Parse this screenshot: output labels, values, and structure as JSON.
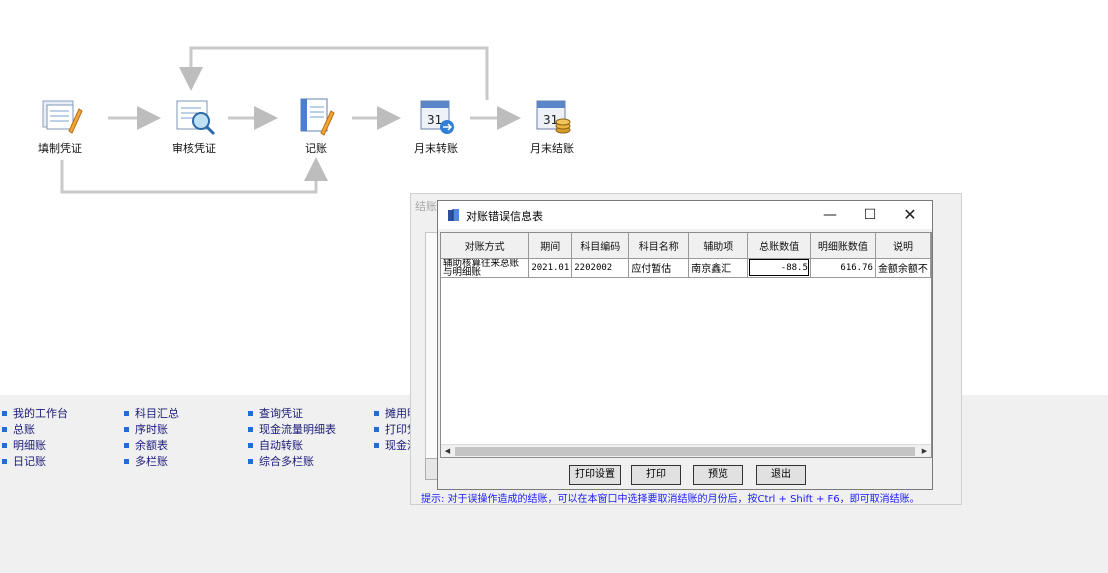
{
  "flow": {
    "nodes": [
      {
        "label": "填制凭证",
        "icon": "voucher-entry-icon"
      },
      {
        "label": "审核凭证",
        "icon": "voucher-review-icon"
      },
      {
        "label": "记账",
        "icon": "posting-icon"
      },
      {
        "label": "月末转账",
        "icon": "month-end-transfer-icon"
      },
      {
        "label": "月末结账",
        "icon": "month-end-close-icon"
      }
    ]
  },
  "background_panel": {
    "title": "结账",
    "tip": "提示: 对于误操作造成的结账，可以在本窗口中选择要取消结账的月份后，按Ctrl + Shift + F6，即可取消结账。"
  },
  "dialog": {
    "title": "对账错误信息表",
    "icon": "book-icon",
    "window_buttons": {
      "minimize": "—",
      "maximize": "☐",
      "close": "✕"
    },
    "columns": [
      "对账方式",
      "期间",
      "科目编码",
      "科目名称",
      "辅助项",
      "总账数值",
      "明细账数值",
      "说明"
    ],
    "rows": [
      {
        "method": "辅助核算往来总账与明细账",
        "period": "2021.01",
        "code": "2202002",
        "name": "应付暂估",
        "aux": "南京鑫汇",
        "gl_value": "-88.5",
        "detail_value": "616.76",
        "note": "金额余额不"
      }
    ],
    "buttons": {
      "print_setup": "打印设置",
      "print": "打印",
      "preview": "预览",
      "exit": "退出"
    }
  },
  "shortcuts": {
    "col1": [
      "我的工作台",
      "总账",
      "明细账",
      "日记账"
    ],
    "col2": [
      "科目汇总",
      "序时账",
      "余额表",
      "多栏账"
    ],
    "col3": [
      "查询凭证",
      "现金流量明细表",
      "自动转账",
      "综合多栏账"
    ],
    "col4": [
      "摊用明",
      "打印凭",
      "现金流"
    ]
  },
  "colors": {
    "tip_text": "#1a1aff",
    "bullet": "#1f6fd1",
    "shortcut_text": "#1a1a7a"
  }
}
